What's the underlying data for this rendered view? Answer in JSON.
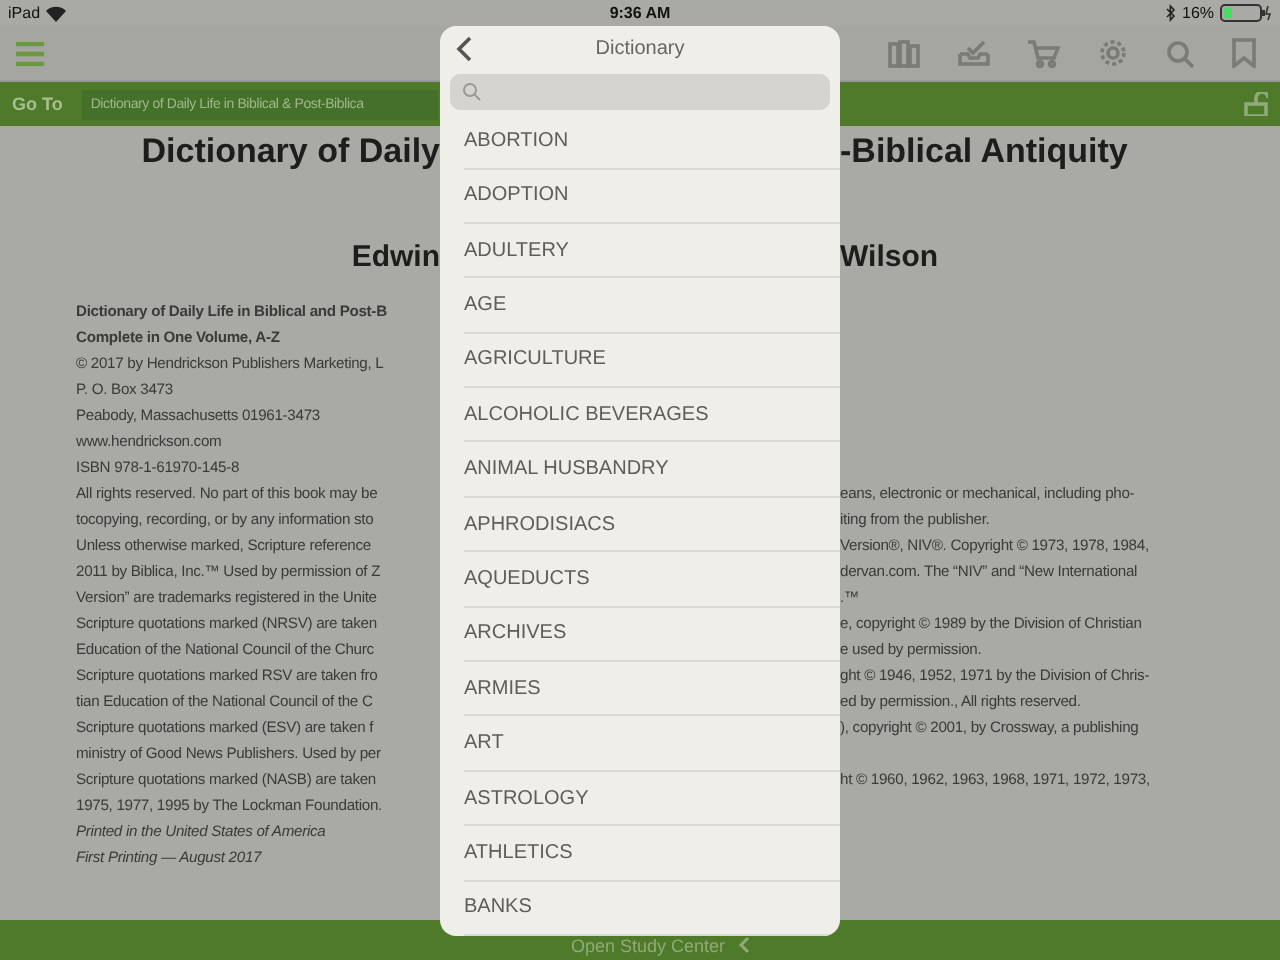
{
  "status_bar": {
    "device": "iPad",
    "time": "9:36 AM",
    "battery": "16%"
  },
  "goto_bar": {
    "label": "Go To",
    "field": "Dictionary of Daily Life in Biblical & Post-Biblica"
  },
  "document": {
    "title": {
      "left": "Dictionary of Daily",
      "right": "-Biblical Antiquity"
    },
    "author": {
      "left": "Edwin",
      "right": "Wilson"
    },
    "lines": [
      {
        "kind": "bold",
        "left": "Dictionary of Daily Life in Biblical and Post-B"
      },
      {
        "kind": "bold",
        "left": "Complete in One Volume, A-Z"
      },
      {
        "kind": "plain",
        "left": "© 2017 by Hendrickson Publishers Marketing, L"
      },
      {
        "kind": "plain",
        "left": "P. O. Box 3473"
      },
      {
        "kind": "plain",
        "left": "Peabody, Massachusetts 01961-3473"
      },
      {
        "kind": "plain",
        "left": "www.hendrickson.com"
      },
      {
        "kind": "plain",
        "left": "ISBN 978-1-61970-145-8"
      },
      {
        "kind": "plain",
        "left": "All rights reserved. No part of this book may be",
        "right": "eans, electronic or mechanical, including pho-"
      },
      {
        "kind": "plain",
        "left": "tocopying, recording, or by any information sto",
        "right": "iting from the publisher."
      },
      {
        "kind": "plain",
        "left": "Unless otherwise marked, Scripture reference",
        "right": "Version®, NIV®. Copyright © 1973, 1978, 1984,"
      },
      {
        "kind": "plain",
        "left": "2011 by Biblica, Inc.™ Used by permission of Z",
        "right": "dervan.com. The “NIV” and “New International"
      },
      {
        "kind": "plain",
        "left": "Version” are trademarks registered in the Unite",
        "right": ".™"
      },
      {
        "kind": "plain",
        "left": "Scripture quotations marked (NRSV) are taken",
        "right": "e, copyright © 1989 by the Division of Christian"
      },
      {
        "kind": "plain",
        "left": "Education of the National Council of the Churc",
        "right": "e used by permission."
      },
      {
        "kind": "plain",
        "left": "Scripture quotations marked RSV are taken fro",
        "right": "ght © 1946, 1952, 1971 by the Division of Chris-"
      },
      {
        "kind": "plain",
        "left": "tian Education of the National Council of the C",
        "right": "ed by permission., All rights reserved."
      },
      {
        "kind": "plain",
        "left": "Scripture quotations marked (ESV) are taken f",
        "right": "), copyright © 2001, by Crossway, a publishing"
      },
      {
        "kind": "plain",
        "left": "ministry of Good News Publishers. Used by per"
      },
      {
        "kind": "plain",
        "left": "Scripture quotations marked (NASB) are taken",
        "right": "ht © 1960, 1962, 1963, 1968, 1971, 1972, 1973,"
      },
      {
        "kind": "plain",
        "left": "1975, 1977, 1995 by The Lockman Foundation."
      },
      {
        "kind": "italic",
        "left": "Printed in the United States of America"
      },
      {
        "kind": "italic",
        "left": "First Printing — August 2017"
      }
    ]
  },
  "popover": {
    "title": "Dictionary",
    "entries": [
      "ABORTION",
      "ADOPTION",
      "ADULTERY",
      "AGE",
      "AGRICULTURE",
      "ALCOHOLIC BEVERAGES",
      "ANIMAL HUSBANDRY",
      "APHRODISIACS",
      "AQUEDUCTS",
      "ARCHIVES",
      "ARMIES",
      "ART",
      "ASTROLOGY",
      "ATHLETICS",
      "BANKS"
    ]
  },
  "bottom_bar": {
    "label": "Open Study Center"
  }
}
